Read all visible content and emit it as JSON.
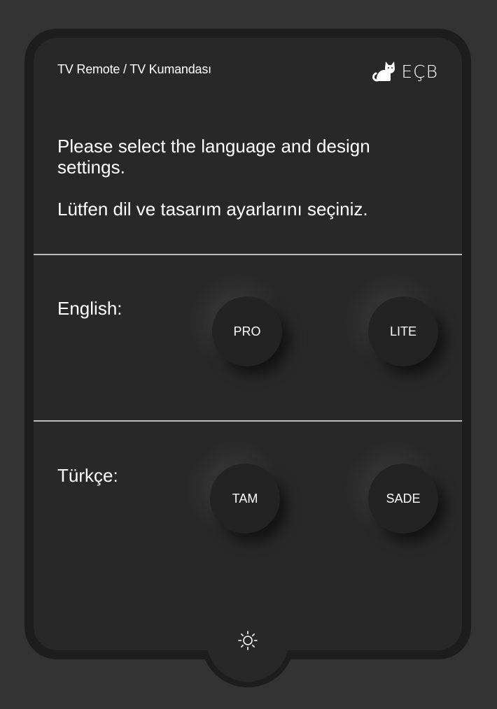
{
  "header": {
    "title": "TV Remote / TV Kumandası",
    "brand": "EÇB",
    "brand_icon": "cat-icon"
  },
  "intro": {
    "english": "Please select the language and design settings.",
    "turkish": "Lütfen dil ve tasarım ayarlarını seçiniz."
  },
  "languages": [
    {
      "label": "English:",
      "options": [
        "PRO",
        "LITE"
      ]
    },
    {
      "label": "Türkçe:",
      "options": [
        "TAM",
        "SADE"
      ]
    }
  ],
  "theme_toggle": {
    "icon": "sun-icon"
  },
  "colors": {
    "background": "#333333",
    "body": "#282828",
    "bezel": "#1d1d1d",
    "button": "#232323",
    "divider": "#bdbdbd",
    "text": "#ffffff"
  }
}
